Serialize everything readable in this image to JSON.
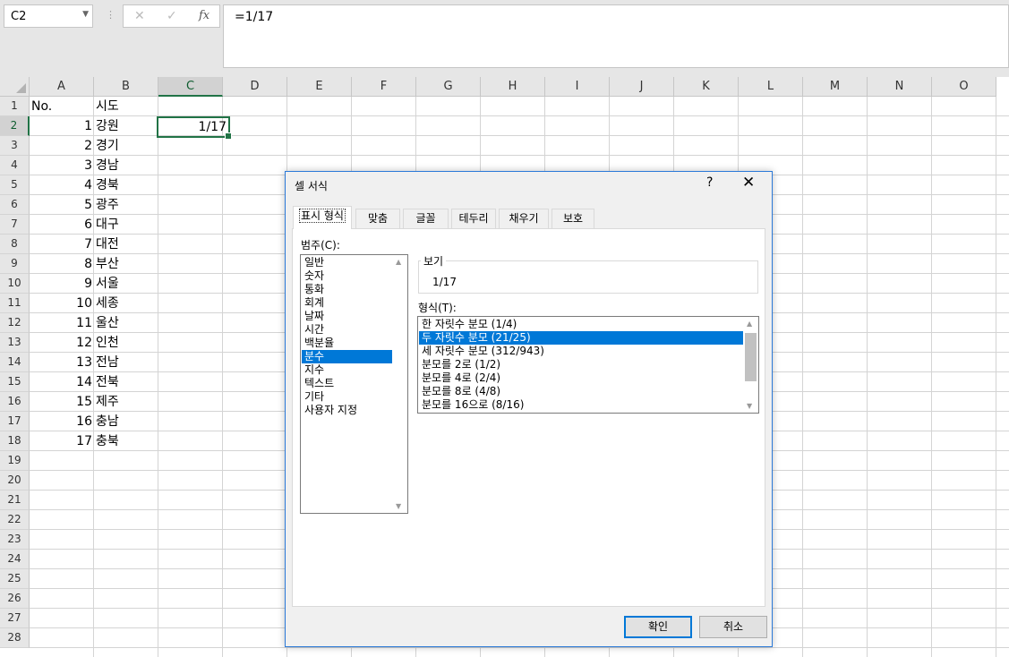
{
  "formula_bar": {
    "name_box": "C2",
    "cancel_icon": "✕",
    "enter_icon": "✓",
    "fx_label": "fx",
    "formula": "=1/17"
  },
  "columns": [
    "A",
    "B",
    "C",
    "D",
    "E",
    "F",
    "G",
    "H",
    "I",
    "J",
    "K",
    "L",
    "M",
    "N",
    "O"
  ],
  "selected_column": "C",
  "rows": [
    "1",
    "2",
    "3",
    "4",
    "5",
    "6",
    "7",
    "8",
    "9",
    "10",
    "11",
    "12",
    "13",
    "14",
    "15",
    "16",
    "17",
    "18",
    "19",
    "20",
    "21",
    "22",
    "23",
    "24",
    "25",
    "26",
    "27",
    "28"
  ],
  "selected_row": "2",
  "cells": {
    "A1": "No.",
    "B1": "시도",
    "col_a": [
      "1",
      "2",
      "3",
      "4",
      "5",
      "6",
      "7",
      "8",
      "9",
      "10",
      "11",
      "12",
      "13",
      "14",
      "15",
      "16",
      "17"
    ],
    "col_b": [
      "강원",
      "경기",
      "경남",
      "경북",
      "광주",
      "대구",
      "대전",
      "부산",
      "서울",
      "세종",
      "울산",
      "인천",
      "전남",
      "전북",
      "제주",
      "충남",
      "충북"
    ],
    "C2": "1/17"
  },
  "dialog": {
    "title": "셀 서식",
    "help": "?",
    "close": "✕",
    "tabs": [
      "표시 형식",
      "맞춤",
      "글꼴",
      "테두리",
      "채우기",
      "보호"
    ],
    "active_tab": "표시 형식",
    "category_label": "범주(C):",
    "categories": [
      "일반",
      "숫자",
      "통화",
      "회계",
      "날짜",
      "시간",
      "백분율",
      "분수",
      "지수",
      "텍스트",
      "기타",
      "사용자 지정"
    ],
    "selected_category": "분수",
    "preview_label": "보기",
    "preview_value": "1/17",
    "type_label": "형식(T):",
    "types": [
      "한 자릿수 분모 (1/4)",
      "두 자릿수 분모 (21/25)",
      "세 자릿수 분모 (312/943)",
      "분모를 2로 (1/2)",
      "분모를 4로 (2/4)",
      "분모를 8로 (4/8)",
      "분모를 16으로 (8/16)"
    ],
    "selected_type": "두 자릿수 분모 (21/25)",
    "ok_label": "확인",
    "cancel_label": "취소"
  },
  "colors": {
    "accent_green": "#217346",
    "selection_blue": "#0078d7",
    "dialog_border": "#2b79d8"
  }
}
